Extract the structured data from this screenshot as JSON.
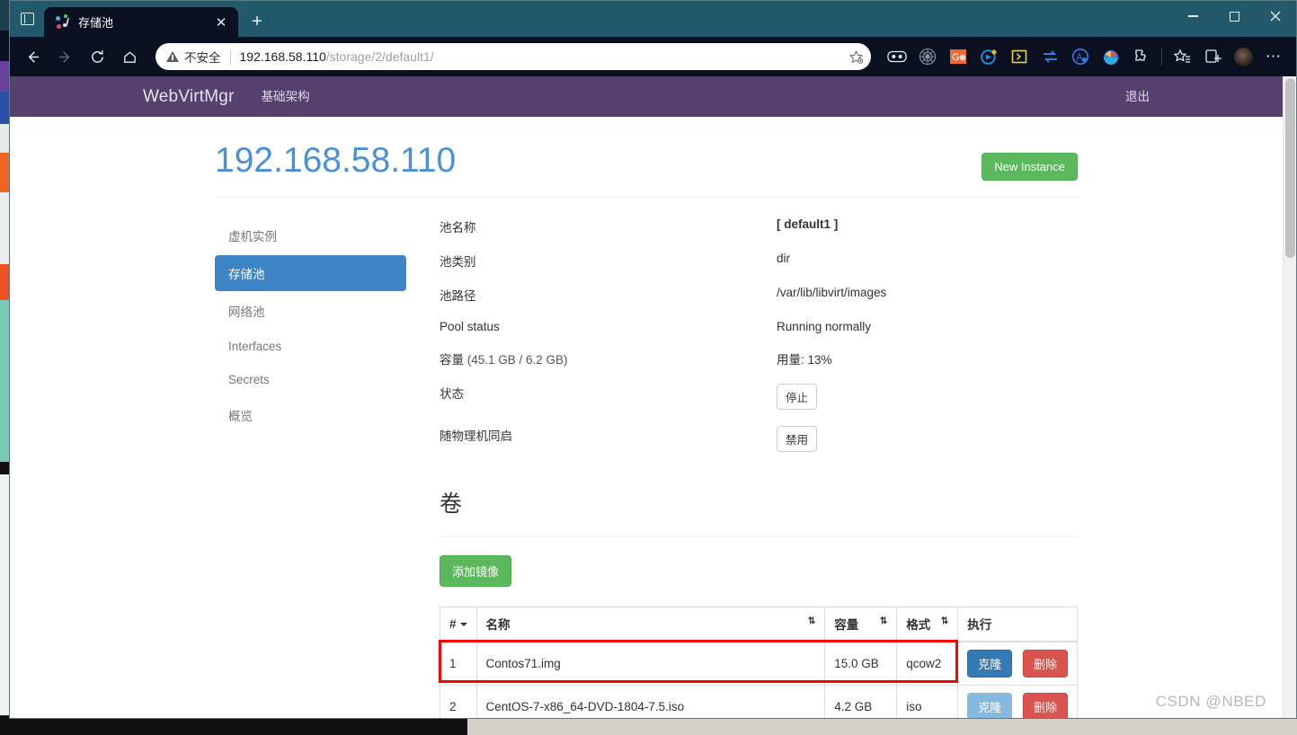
{
  "browser": {
    "tab": {
      "title": "存储池",
      "close_label": "✕"
    },
    "newtab_label": "+",
    "window_controls": {
      "minimize": "—",
      "maximize": "□",
      "close": "✕"
    },
    "omnibox": {
      "security_label": "不安全",
      "url_host": "192.168.58.110",
      "url_path": "/storage/2/default1/"
    },
    "toolbar_icons": [
      "goggles-extension-icon",
      "spiderweb-extension-icon",
      "grammar-extension-icon",
      "clock-extension-icon",
      "console-extension-icon",
      "sync-extension-icon",
      "adblock-extension-icon",
      "color-extension-icon",
      "puzzle-extensions-icon",
      "favorites-star-icon",
      "collections-icon",
      "profile-avatar",
      "settings-more-icon"
    ]
  },
  "app": {
    "brand": "WebVirtMgr",
    "nav_infrastructure": "基础架构",
    "nav_logout": "退出",
    "page_title": "192.168.58.110",
    "new_instance_label": "New Instance"
  },
  "sidebar": {
    "items": [
      {
        "label": "虚机实例",
        "active": false
      },
      {
        "label": "存储池",
        "active": true
      },
      {
        "label": "网络池",
        "active": false
      },
      {
        "label": "Interfaces",
        "active": false
      },
      {
        "label": "Secrets",
        "active": false
      },
      {
        "label": "概览",
        "active": false
      }
    ]
  },
  "pool_details": [
    {
      "term": "池名称",
      "term_sub": "",
      "value": "[ default1 ]",
      "bold": true,
      "type": "text"
    },
    {
      "term": "池类别",
      "term_sub": "",
      "value": "dir",
      "bold": false,
      "type": "text"
    },
    {
      "term": "池路径",
      "term_sub": "",
      "value": "/var/lib/libvirt/images",
      "bold": false,
      "type": "text"
    },
    {
      "term": "Pool status",
      "term_sub": "",
      "value": "Running normally",
      "bold": false,
      "type": "text"
    },
    {
      "term": "容量",
      "term_sub": " (45.1 GB / 6.2 GB)",
      "value": "用量: 13%",
      "bold": false,
      "type": "text"
    },
    {
      "term": "状态",
      "term_sub": "",
      "value": "停止",
      "bold": false,
      "type": "button"
    },
    {
      "term": "随物理机同启",
      "term_sub": "",
      "value": "禁用",
      "bold": false,
      "type": "button"
    }
  ],
  "volumes": {
    "section_title": "卷",
    "add_image_label": "添加镜像",
    "columns": [
      "#",
      "名称",
      "容量",
      "格式",
      "执行"
    ],
    "rows": [
      {
        "num": "1",
        "name": "Contos71.img",
        "capacity": "15.0 GB",
        "format": "qcow2",
        "clone_label": "克隆",
        "delete_label": "删除",
        "clone_muted": false,
        "highlighted": true
      },
      {
        "num": "2",
        "name": "CentOS-7-x86_64-DVD-1804-7.5.iso",
        "capacity": "4.2 GB",
        "format": "iso",
        "clone_label": "克隆",
        "delete_label": "删除",
        "clone_muted": true,
        "highlighted": false
      }
    ]
  },
  "watermark": "CSDN @NBED",
  "colors": {
    "brand_purple": "#55406e",
    "accent_blue": "#4a90d9",
    "sidebar_active": "#3d85c6",
    "success_green": "#5cb85c",
    "danger_red": "#d9534f",
    "highlight_red": "#ff0000",
    "browser_chrome": "#235a6b"
  }
}
